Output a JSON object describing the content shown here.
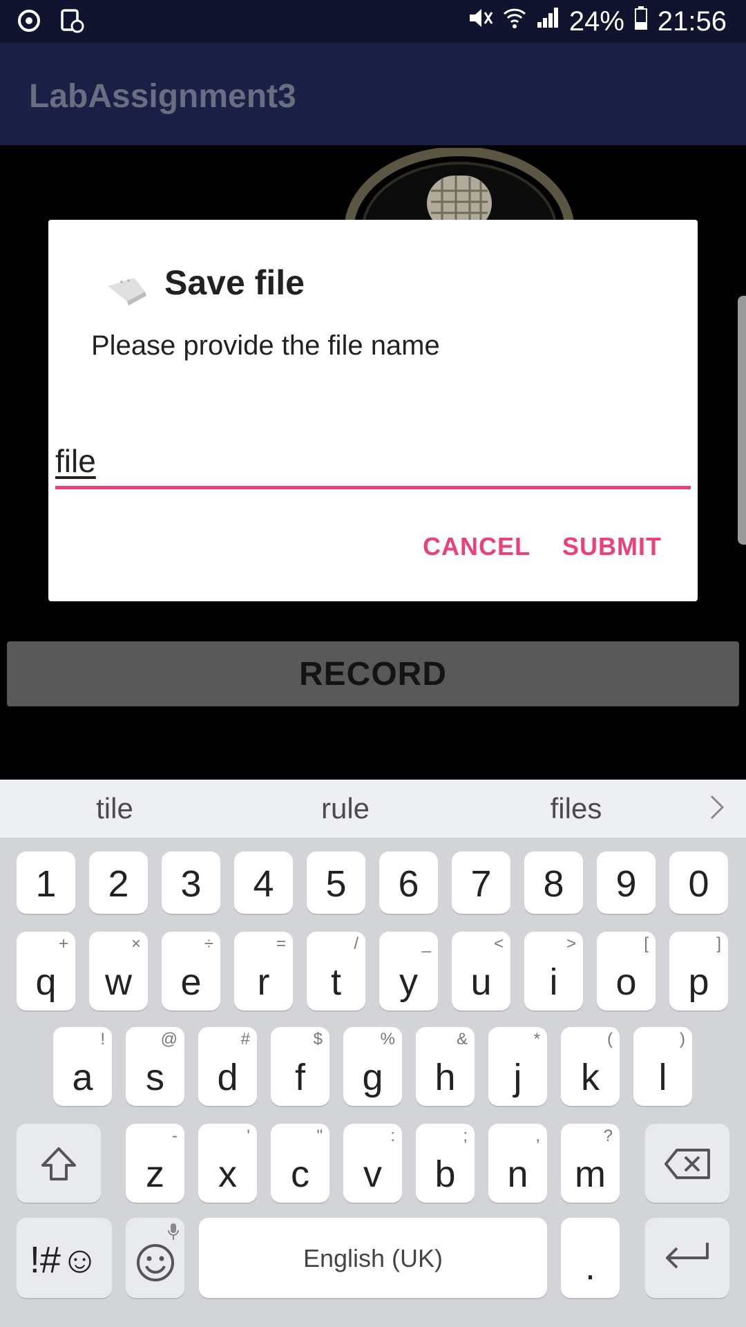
{
  "status_bar": {
    "battery": "24%",
    "time": "21:56"
  },
  "app_bar": {
    "title": "LabAssignment3"
  },
  "main": {
    "record_label": "RECORD"
  },
  "dialog": {
    "title": "Save file",
    "message": "Please provide the file name",
    "input_value": "file",
    "cancel_label": "CANCEL",
    "submit_label": "SUBMIT",
    "accent_color": "#ec407a"
  },
  "keyboard": {
    "suggestions": [
      "tile",
      "rule",
      "files"
    ],
    "number_row": [
      "1",
      "2",
      "3",
      "4",
      "5",
      "6",
      "7",
      "8",
      "9",
      "0"
    ],
    "row1": [
      {
        "k": "q",
        "s": "+"
      },
      {
        "k": "w",
        "s": "×"
      },
      {
        "k": "e",
        "s": "÷"
      },
      {
        "k": "r",
        "s": "="
      },
      {
        "k": "t",
        "s": "/"
      },
      {
        "k": "y",
        "s": "_"
      },
      {
        "k": "u",
        "s": "<"
      },
      {
        "k": "i",
        "s": ">"
      },
      {
        "k": "o",
        "s": "["
      },
      {
        "k": "p",
        "s": "]"
      }
    ],
    "row2": [
      {
        "k": "a",
        "s": "!"
      },
      {
        "k": "s",
        "s": "@"
      },
      {
        "k": "d",
        "s": "#"
      },
      {
        "k": "f",
        "s": "$"
      },
      {
        "k": "g",
        "s": "%"
      },
      {
        "k": "h",
        "s": "&"
      },
      {
        "k": "j",
        "s": "*"
      },
      {
        "k": "k",
        "s": "("
      },
      {
        "k": "l",
        "s": ")"
      }
    ],
    "row3": [
      {
        "k": "z",
        "s": "-"
      },
      {
        "k": "x",
        "s": "'"
      },
      {
        "k": "c",
        "s": "\""
      },
      {
        "k": "v",
        "s": ":"
      },
      {
        "k": "b",
        "s": ";"
      },
      {
        "k": "n",
        "s": ","
      },
      {
        "k": "m",
        "s": "?"
      }
    ],
    "symbols_label": "!#☺",
    "space_label": "English (UK)",
    "period_label": "."
  }
}
